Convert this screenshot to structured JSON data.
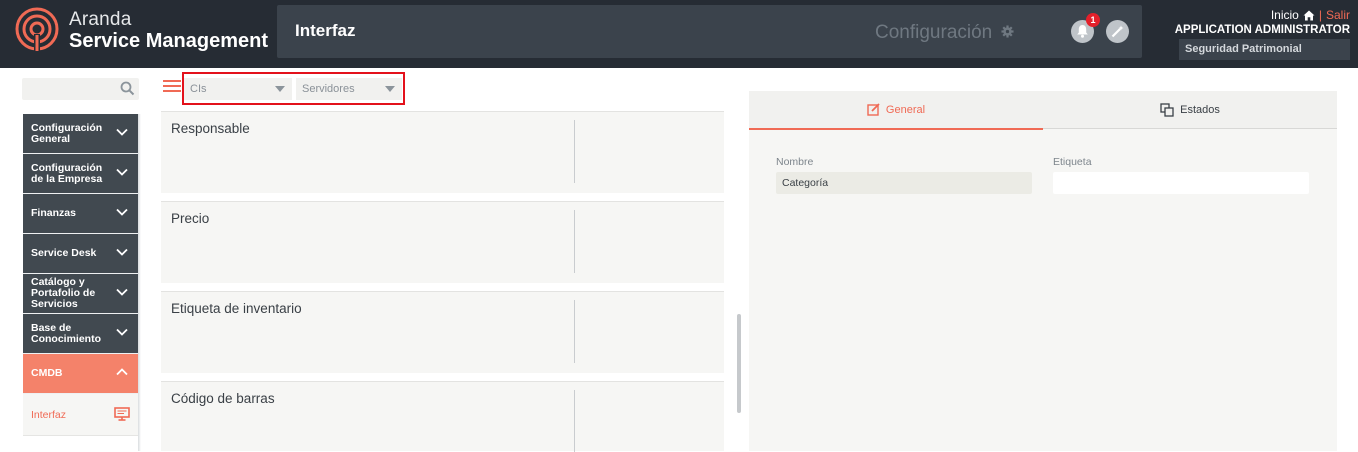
{
  "header": {
    "brand_line1": "Aranda",
    "brand_line2": "Service Management",
    "page_title": "Interfaz",
    "config_label": "Configuración",
    "notification_count": "1",
    "link_home": "Inicio",
    "link_separator": "|",
    "link_logout": "Salir",
    "user_name": "APPLICATION ADMINISTRATOR",
    "user_area": "Seguridad Patrimonial"
  },
  "colors": {
    "header_bg": "#262c34",
    "accent": "#f06a55",
    "menu_bg": "#414950",
    "menu_active_bg": "#f4826a",
    "highlight_box": "#e3111b"
  },
  "sidebar": {
    "items": [
      {
        "label": "Configuración General"
      },
      {
        "label": "Configuración de la Empresa"
      },
      {
        "label": "Finanzas"
      },
      {
        "label": "Service Desk"
      },
      {
        "label": "Catálogo y Portafolio de Servicios"
      },
      {
        "label": "Base de Conocimiento"
      },
      {
        "label": "CMDB"
      }
    ],
    "sub_item": "Interfaz"
  },
  "filters": {
    "type_value": "CIs",
    "category_value": "Servidores"
  },
  "fields": [
    {
      "label": "Responsable"
    },
    {
      "label": "Precio"
    },
    {
      "label": "Etiqueta de inventario"
    },
    {
      "label": "Código de barras"
    }
  ],
  "panel": {
    "tab_general": "General",
    "tab_estados": "Estados",
    "name_label": "Nombre",
    "name_value": "Categoría",
    "tag_label": "Etiqueta",
    "tag_value": ""
  }
}
